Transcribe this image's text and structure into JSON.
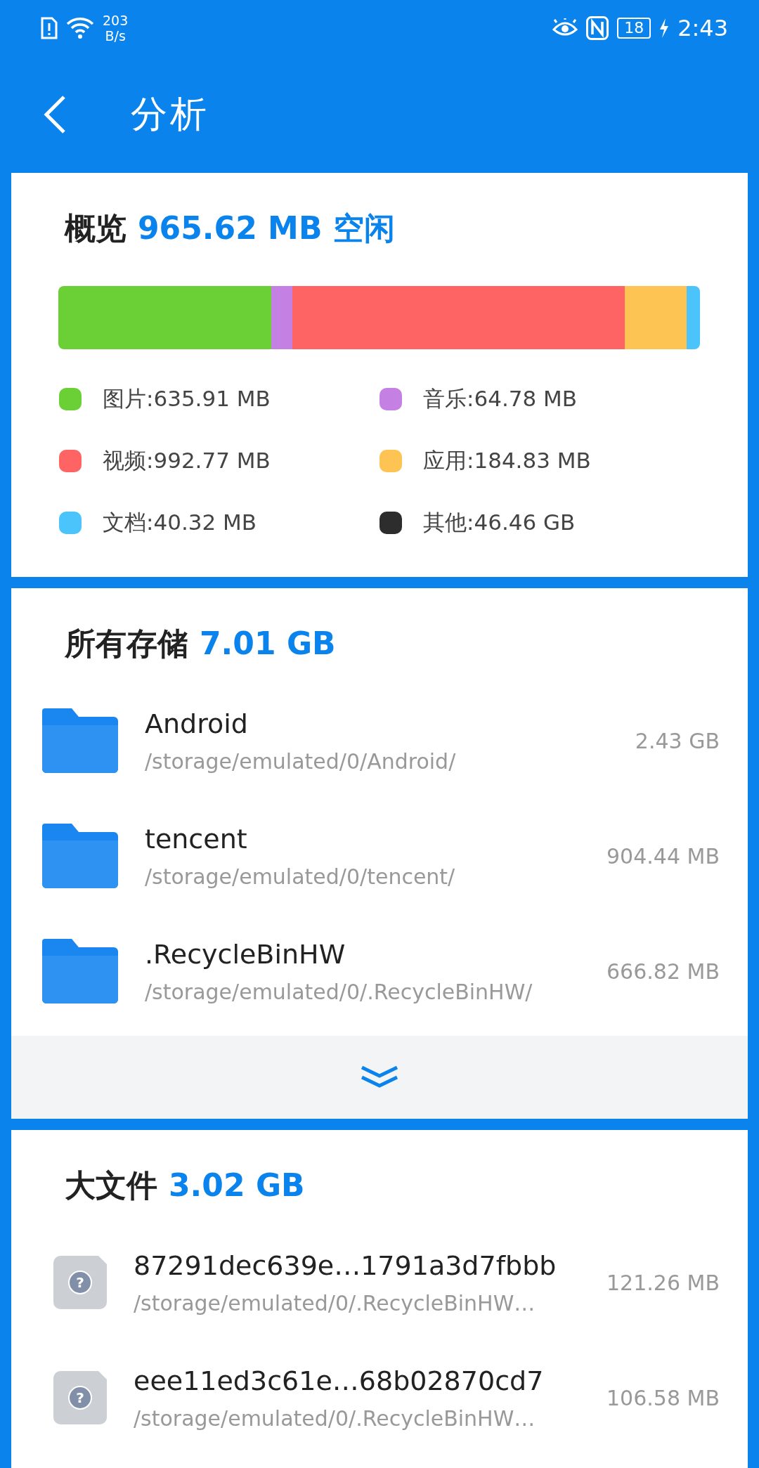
{
  "status_bar": {
    "speed_value": "203",
    "speed_unit": "B/s",
    "battery": "18",
    "time": "2:43"
  },
  "header": {
    "title": "分析"
  },
  "overview": {
    "title": "概览",
    "value": "965.62 MB 空闲",
    "categories": [
      {
        "label": "图片:635.91 MB",
        "color": "#6ad035",
        "in_bar": true
      },
      {
        "label": "音乐:64.78 MB",
        "color": "#c580e3",
        "in_bar": true
      },
      {
        "label": "视频:992.77 MB",
        "color": "#fd6463",
        "in_bar": true
      },
      {
        "label": "应用:184.83 MB",
        "color": "#fdc453",
        "in_bar": true
      },
      {
        "label": "文档:40.32 MB",
        "color": "#4bc4fb",
        "in_bar": true
      },
      {
        "label": "其他:46.46 GB",
        "color": "#2d2d2d",
        "in_bar": false
      }
    ]
  },
  "storage": {
    "title": "所有存储",
    "value": "7.01 GB",
    "items": [
      {
        "name": "Android",
        "path": "/storage/emulated/0/Android/",
        "size": "2.43 GB"
      },
      {
        "name": "tencent",
        "path": "/storage/emulated/0/tencent/",
        "size": "904.44 MB"
      },
      {
        "name": ".RecycleBinHW",
        "path": "/storage/emulated/0/.RecycleBinHW/",
        "size": "666.82 MB"
      }
    ]
  },
  "large_files": {
    "title": "大文件",
    "value": "3.02 GB",
    "icon_glyph": "?",
    "items": [
      {
        "name": "87291dec639e…1791a3d7fbbb",
        "path": "/storage/emulated/0/.RecycleBinHW…",
        "size": "121.26 MB"
      },
      {
        "name": "eee11ed3c61e…68b02870cd7",
        "path": "/storage/emulated/0/.RecycleBinHW…",
        "size": "106.58 MB"
      }
    ]
  }
}
